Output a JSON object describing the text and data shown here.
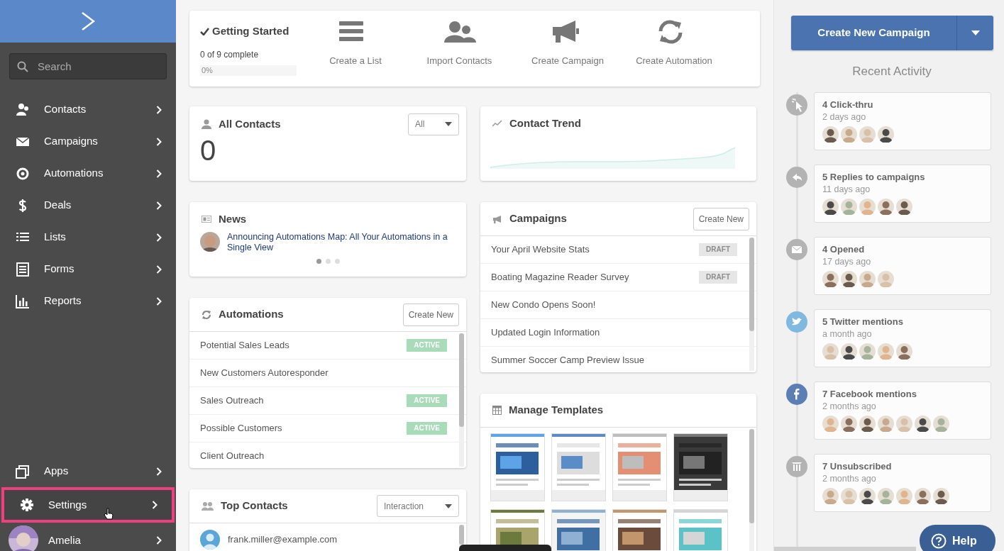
{
  "sidebar": {
    "search": {
      "placeholder": "Search"
    },
    "items": [
      {
        "label": "Contacts",
        "selected": false
      },
      {
        "label": "Campaigns",
        "selected": false
      },
      {
        "label": "Automations",
        "selected": false
      },
      {
        "label": "Deals",
        "selected": false
      },
      {
        "label": "Lists",
        "selected": false
      },
      {
        "label": "Forms",
        "selected": false
      },
      {
        "label": "Reports",
        "selected": false
      }
    ],
    "bottom_items": [
      {
        "label": "Apps",
        "selected": false
      },
      {
        "label": "Settings",
        "selected": true
      }
    ],
    "user": {
      "name": "Amelia"
    }
  },
  "getting_started": {
    "title": "Getting Started",
    "progress_text": "0 of 9 complete",
    "level": 0,
    "progress_label": "0%",
    "steps": [
      {
        "label": "Create a List"
      },
      {
        "label": "Import Contacts"
      },
      {
        "label": "Create Campaign"
      },
      {
        "label": "Create Automation"
      }
    ]
  },
  "all_contacts": {
    "title": "All Contacts",
    "filter": "All",
    "count": "0"
  },
  "news": {
    "title": "News",
    "headline": "Announcing Automations Map: All Your Automations in a Single View",
    "dots": [
      {
        "selected": true
      },
      {
        "selected": false
      },
      {
        "selected": false
      }
    ]
  },
  "automations": {
    "title": "Automations",
    "button": "Create New",
    "rows": [
      {
        "name": "Potential Sales Leads",
        "status": "ACTIVE"
      },
      {
        "name": "New Customers Autoresponder"
      },
      {
        "name": "Sales Outreach",
        "status": "ACTIVE"
      },
      {
        "name": "Possible Customers",
        "status": "ACTIVE"
      },
      {
        "name": "Client Outreach"
      }
    ]
  },
  "top_contacts": {
    "title": "Top Contacts",
    "filter": "Interaction",
    "rows": [
      {
        "email": "frank.miller@example.com"
      }
    ]
  },
  "contact_trend": {
    "title": "Contact Trend"
  },
  "campaigns": {
    "title": "Campaigns",
    "button": "Create New",
    "rows": [
      {
        "name": "Your April Website Stats",
        "status": "DRAFT"
      },
      {
        "name": "Boating Magazine Reader Survey",
        "status": "DRAFT"
      },
      {
        "name": "New Condo Opens Soon!"
      },
      {
        "name": "Updated Login Information"
      },
      {
        "name": "Summer Soccer Camp Preview Issue"
      }
    ]
  },
  "templates": {
    "title": "Manage Templates"
  },
  "right_panel": {
    "create_button": "Create New Campaign",
    "heading": "Recent Activity",
    "activity": [
      {
        "title": "4 Click-thru",
        "time": "2 days ago",
        "color": "#b3b3b3"
      },
      {
        "title": "5 Replies to campaigns",
        "time": "11 days ago",
        "color": "#b3b3b3"
      },
      {
        "title": "4 Opened",
        "time": "17 days ago",
        "color": "#b3b3b3"
      },
      {
        "title": "5 Twitter mentions",
        "time": "a month ago",
        "color": "#7fb9e0"
      },
      {
        "title": "7 Facebook mentions",
        "time": "2 months ago",
        "color": "#5b7fb5"
      },
      {
        "title": "7 Unsubscribed",
        "time": "2 months ago",
        "color": "#b3b3b3"
      }
    ],
    "help_button": "Help"
  }
}
